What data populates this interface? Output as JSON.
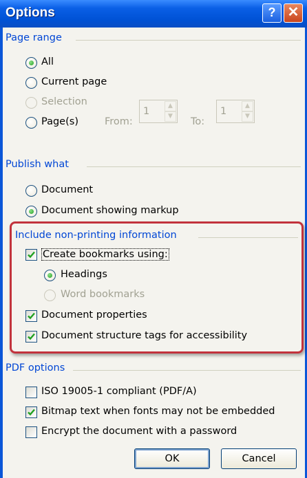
{
  "window": {
    "title": "Options",
    "help_glyph": "?",
    "close_glyph": "✕"
  },
  "page_range": {
    "label": "Page range",
    "all_label": "All",
    "current_label": "Current page",
    "selection_label": "Selection",
    "pages_label": "Page(s)",
    "from_label": "From:",
    "from_value": "1",
    "to_label": "To:",
    "to_value": "1",
    "selected": "all"
  },
  "publish_what": {
    "label": "Publish what",
    "document_label": "Document",
    "markup_label": "Document showing markup",
    "selected": "markup"
  },
  "non_printing": {
    "label": "Include non-printing information",
    "bookmarks_label": "Create bookmarks using:",
    "bookmarks_checked": true,
    "headings_label": "Headings",
    "word_bookmarks_label": "Word bookmarks",
    "properties_label": "Document properties",
    "properties_checked": true,
    "structure_label": "Document structure tags for accessibility",
    "structure_checked": true
  },
  "pdf_options": {
    "label": "PDF options",
    "iso_label": "ISO 19005-1 compliant (PDF/A)",
    "iso_checked": false,
    "bitmap_label": "Bitmap text when fonts may not be embedded",
    "bitmap_checked": true,
    "encrypt_label": "Encrypt the document with a password",
    "encrypt_checked": false
  },
  "buttons": {
    "ok_label": "OK",
    "cancel_label": "Cancel"
  },
  "colors": {
    "section_header": "#0046d5",
    "highlight_border": "#c2323c",
    "title_bar": "#0052d6"
  }
}
